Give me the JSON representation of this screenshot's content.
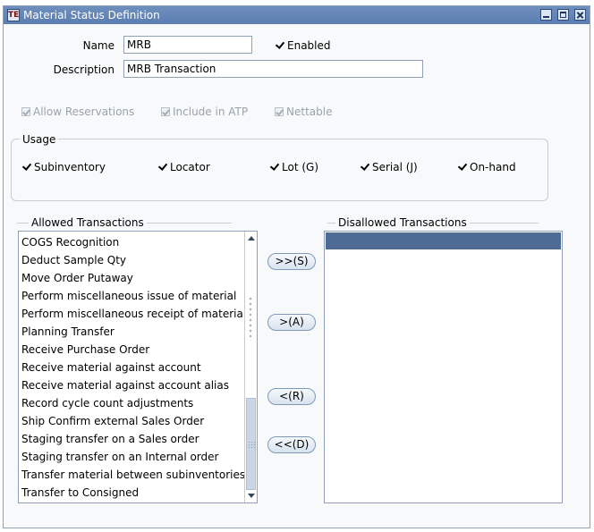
{
  "window": {
    "title": "Material Status Definition",
    "icon_glyph": "TE"
  },
  "form": {
    "name_label": "Name",
    "name_value": "MRB",
    "enabled_label": "Enabled",
    "description_label": "Description",
    "description_value": "MRB Transaction"
  },
  "options": {
    "allow_reservations": "Allow Reservations",
    "include_in_atp": "Include in ATP",
    "nettable": "Nettable"
  },
  "usage": {
    "title": "Usage",
    "items": [
      "Subinventory",
      "Locator",
      "Lot (G)",
      "Serial (J)",
      "On-hand"
    ]
  },
  "allowed": {
    "title": "Allowed Transactions",
    "items": [
      "COGS Recognition",
      "Deduct Sample Qty",
      "Move Order Putaway",
      "Perform miscellaneous issue of material",
      "Perform miscellaneous receipt of material",
      "Planning Transfer",
      "Receive Purchase Order",
      "Receive material against account",
      "Receive material against account alias",
      "Record cycle count adjustments",
      "Ship Confirm external Sales Order",
      "Staging transfer on a Sales order",
      "Staging transfer on an Internal order",
      "Transfer material between subinventories",
      "Transfer to Consigned"
    ]
  },
  "disallowed": {
    "title": "Disallowed Transactions",
    "items": []
  },
  "buttons": {
    "move_all_right": ">>(S)",
    "move_right": ">(A)",
    "move_left": "<(R)",
    "move_all_left": "<<(D)"
  },
  "colors": {
    "titlebar": "#5b7db0",
    "selection": "#4d6b95",
    "background": "#f7f9fa"
  }
}
